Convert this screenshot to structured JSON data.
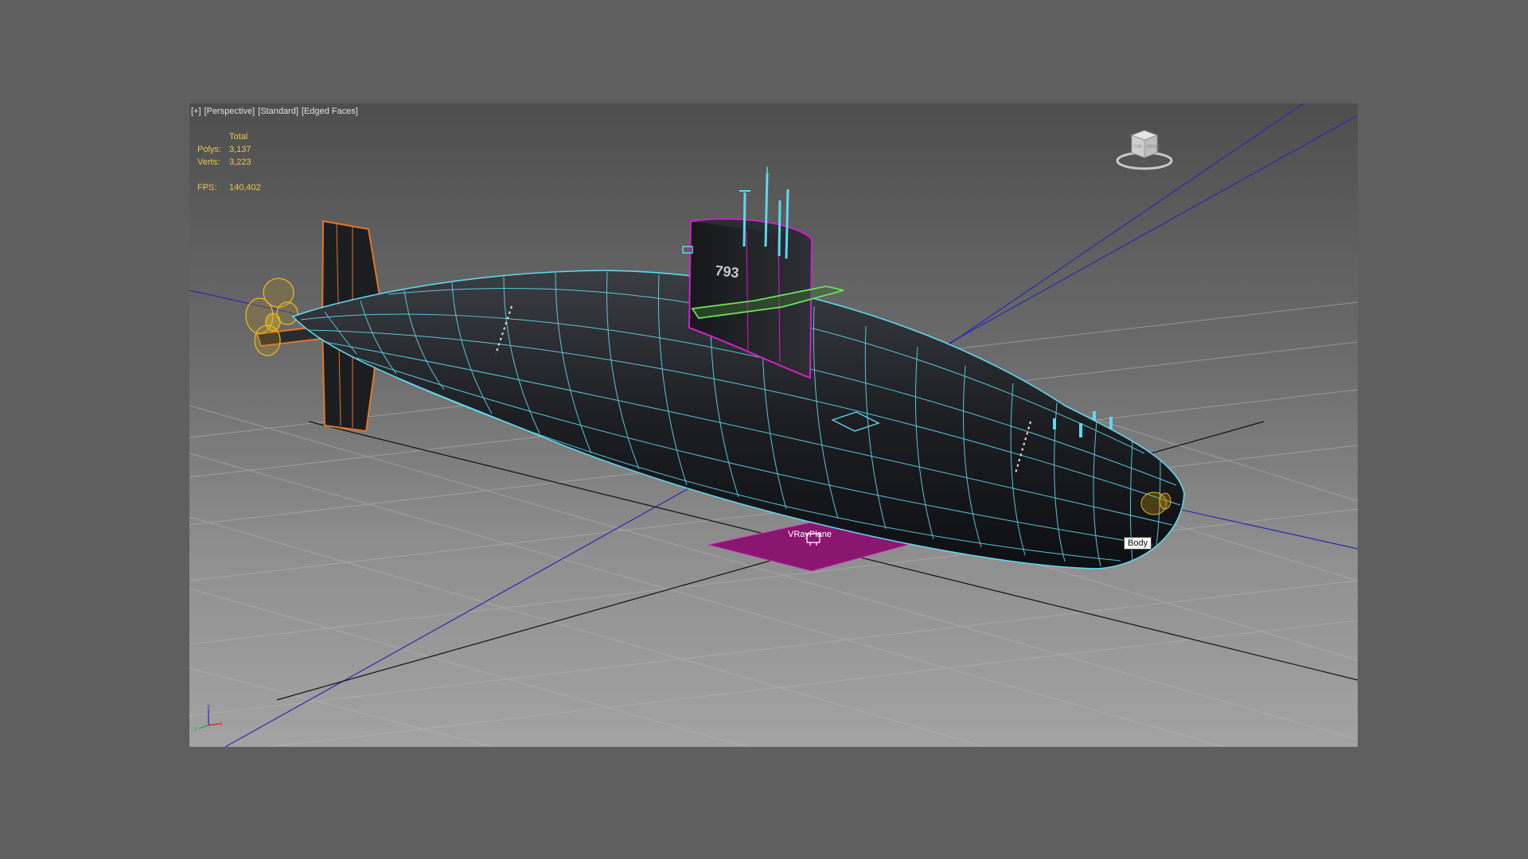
{
  "viewport": {
    "labels": [
      "[+]",
      "[Perspective]",
      "[Standard]",
      "[Edged Faces]"
    ]
  },
  "stats": {
    "header": "Total",
    "polys_label": "Polys:",
    "polys_value": "3,137",
    "verts_label": "Verts:",
    "verts_value": "3,223",
    "fps_label": "FPS:",
    "fps_value": "140,402"
  },
  "scene": {
    "tooltip": "Body",
    "plane_label": "VRayPlane",
    "hull_number": "793"
  },
  "viewcube": {
    "face_left": "TOP",
    "face_right": "FRONT"
  },
  "axes": {
    "z": "z",
    "y": "y",
    "x": "x"
  },
  "colors": {
    "wire": "#5fd7ee",
    "sail_wire": "#d020c8",
    "prop": "#e8b820",
    "fin": "#e07828",
    "plane": "#8a1670",
    "planes_green": "#6ee05a"
  }
}
